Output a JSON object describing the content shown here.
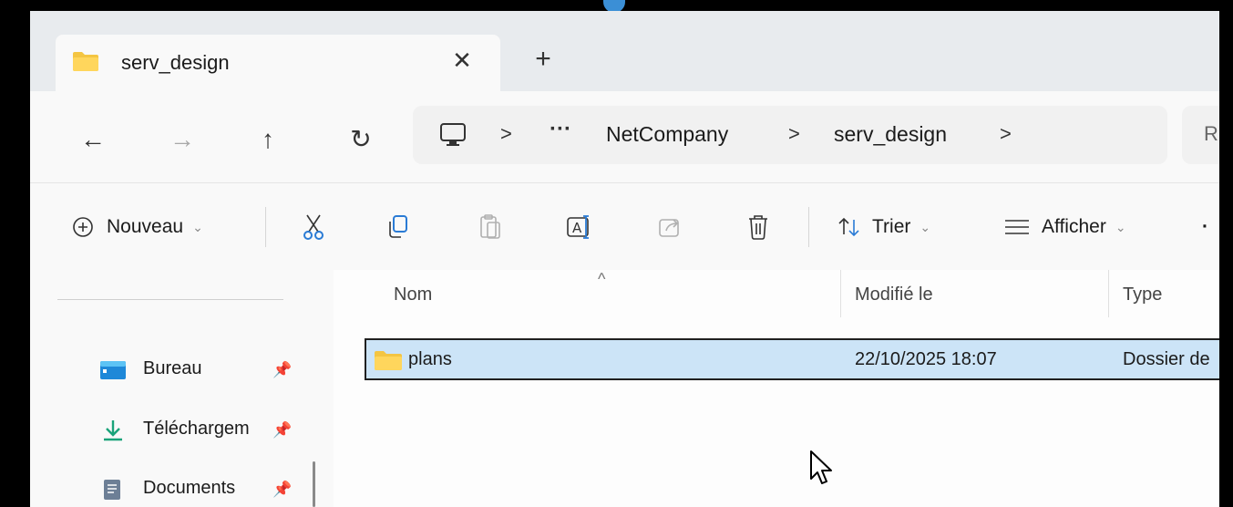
{
  "window": {
    "tab": {
      "title": "serv_design",
      "icon": "folder-icon",
      "close_icon": "close-icon"
    },
    "new_tab_icon": "plus-icon"
  },
  "navigation": {
    "back_icon": "arrow-left-icon",
    "forward_icon": "arrow-right-icon",
    "up_icon": "arrow-up-icon",
    "refresh_icon": "refresh-icon",
    "breadcrumb": {
      "root_icon": "pc-icon",
      "separator": ">",
      "more": "···",
      "items": [
        "NetCompany",
        "serv_design"
      ]
    },
    "search_placeholder": "R"
  },
  "commandbar": {
    "new_label": "Nouveau",
    "sort_label": "Trier",
    "view_label": "Afficher",
    "dropdown_caret": "⌄",
    "more": "·"
  },
  "sidebar": {
    "items": [
      {
        "label": "Bureau",
        "icon": "desktop-icon",
        "pinned": true
      },
      {
        "label": "Téléchargem",
        "icon": "download-icon",
        "pinned": true
      },
      {
        "label": "Documents",
        "icon": "documents-icon",
        "pinned": true
      }
    ],
    "pin_glyph": "📌"
  },
  "filelist": {
    "sort_indicator": "^",
    "columns": [
      "Nom",
      "Modifié le",
      "Type"
    ],
    "rows": [
      {
        "name": "plans",
        "modified": "22/10/2025 18:07",
        "type": "Dossier de",
        "selected": true
      }
    ]
  },
  "colors": {
    "selection": "#cce4f7",
    "folder": "#f4c542",
    "accent": "#3b8fd6"
  }
}
